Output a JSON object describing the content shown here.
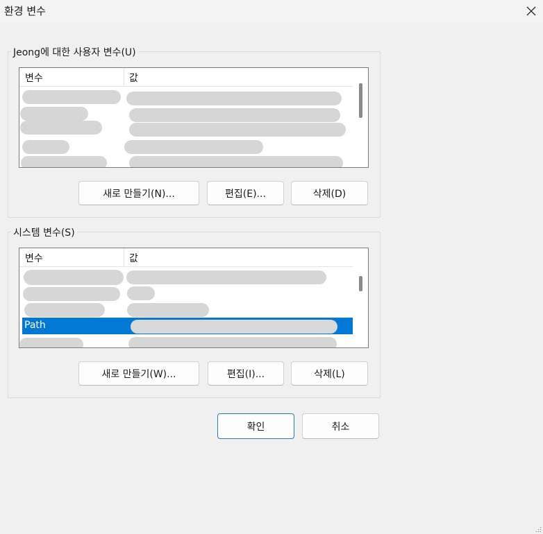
{
  "window": {
    "title": "환경 변수"
  },
  "user_group": {
    "label": "Jeong에 대한 사용자 변수(U)",
    "columns": [
      "변수",
      "값"
    ],
    "buttons": {
      "new": "새로 만들기(N)...",
      "edit": "편집(E)...",
      "delete": "삭제(D)"
    }
  },
  "system_group": {
    "label": "시스템 변수(S)",
    "columns": [
      "변수",
      "값"
    ],
    "selected_row": {
      "variable": "Path"
    },
    "buttons": {
      "new": "새로 만들기(W)...",
      "edit": "편집(I)...",
      "delete": "삭제(L)"
    }
  },
  "dialog_buttons": {
    "ok": "확인",
    "cancel": "취소"
  },
  "icons": {
    "close": "close-icon",
    "resize_grip": "resize-grip-icon"
  },
  "colors": {
    "selection": "#0078d4",
    "primary_border": "#2a7ab8"
  }
}
